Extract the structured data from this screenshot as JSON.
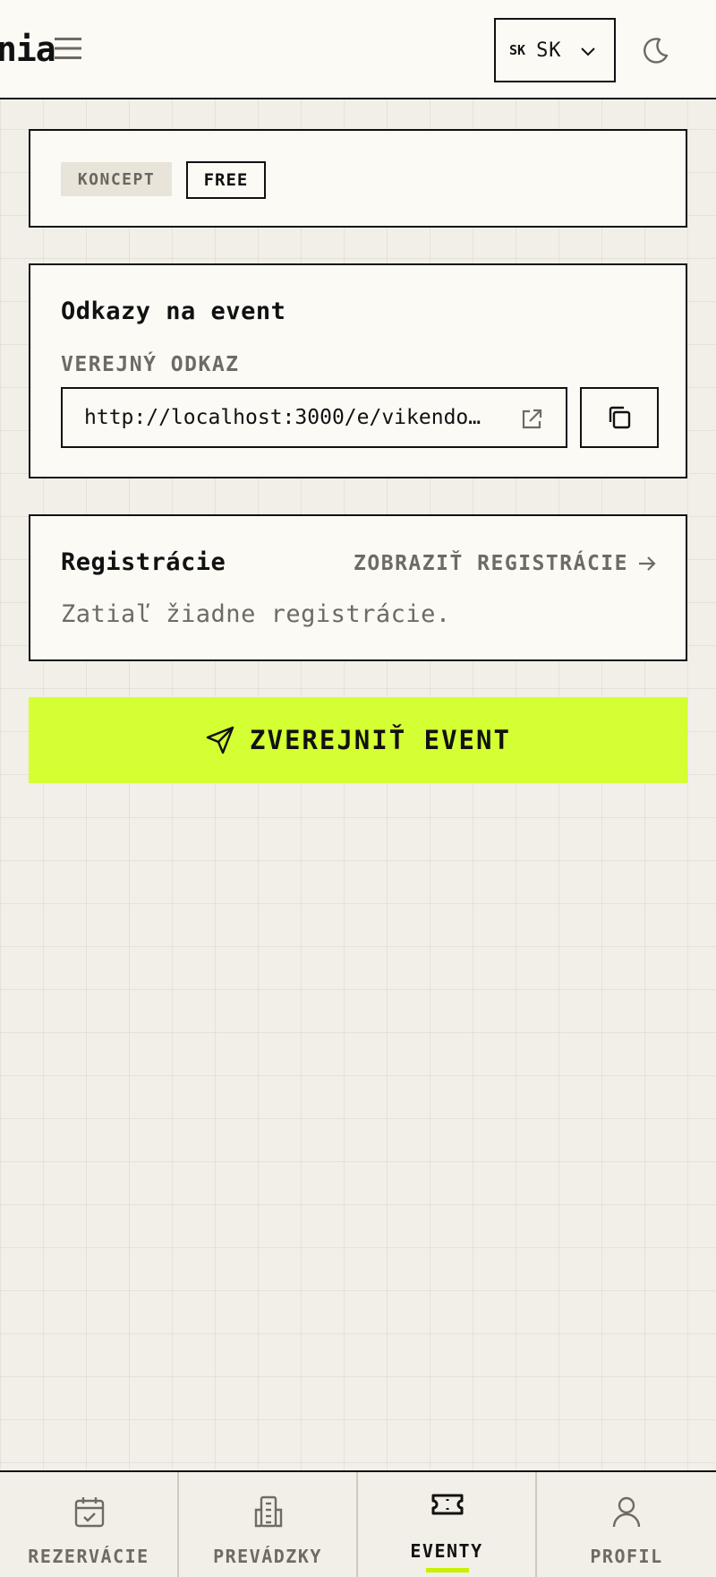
{
  "header": {
    "logo_fragment": "nia",
    "language": {
      "code": "SK",
      "label": "SK"
    }
  },
  "status_card": {
    "status_badge": "KONCEPT",
    "price_badge": "FREE"
  },
  "links_card": {
    "title": "Odkazy na event",
    "public_link_label": "VEREJNÝ ODKAZ",
    "public_link_value": "http://localhost:3000/e/vikendo…"
  },
  "registrations_card": {
    "title": "Registrácie",
    "view_link_label": "ZOBRAZIŤ REGISTRÁCIE",
    "empty_text": "Zatiaľ žiadne registrácie."
  },
  "publish_button": {
    "label": "ZVEREJNIŤ EVENT"
  },
  "bottom_nav": {
    "items": [
      {
        "label": "REZERVÁCIE",
        "icon": "calendar-check-icon"
      },
      {
        "label": "PREVÁDZKY",
        "icon": "building-icon"
      },
      {
        "label": "EVENTY",
        "icon": "ticket-icon"
      },
      {
        "label": "PROFIL",
        "icon": "user-icon"
      }
    ],
    "active": "EVENTY"
  },
  "colors": {
    "accent": "#d4ff33",
    "background": "#f2efe8",
    "card": "#fbfaf5",
    "muted_text": "#6e6a64",
    "border": "#111111"
  }
}
